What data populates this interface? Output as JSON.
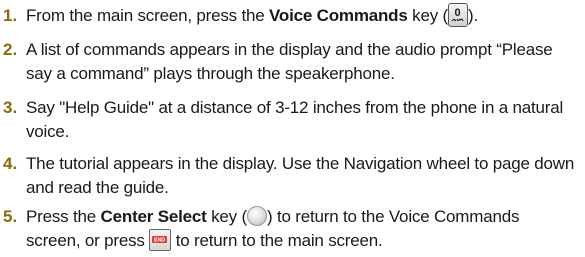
{
  "steps": [
    {
      "number": "1.",
      "before": "From the main screen, press the ",
      "bold": "Voice Commands",
      "after_key_prefix": " key (",
      "key_icon": "voice-commands-key-icon",
      "after": ")."
    },
    {
      "number": "2.",
      "line1": "A list of commands appears in the display and the audio prompt “Please",
      "line2": "say a command” plays through the speakerphone."
    },
    {
      "number": "3.",
      "line1": "Say \"Help Guide\" at a distance of 3-12 inches from the phone in a natural",
      "line2": "voice."
    },
    {
      "number": "4.",
      "line1": "The tutorial appears in the display. Use the Navigation wheel to page down",
      "line2": "and read the guide."
    },
    {
      "number": "5.",
      "before": "Press the ",
      "bold": "Center Select",
      "after_key_prefix": " key (",
      "key_icon": "center-select-key-icon",
      "after": ") to return to the Voice Commands",
      "line2_before": "screen, or press ",
      "end_key_icon": "end-key-icon",
      "line2_after": " to return to the main screen."
    }
  ]
}
